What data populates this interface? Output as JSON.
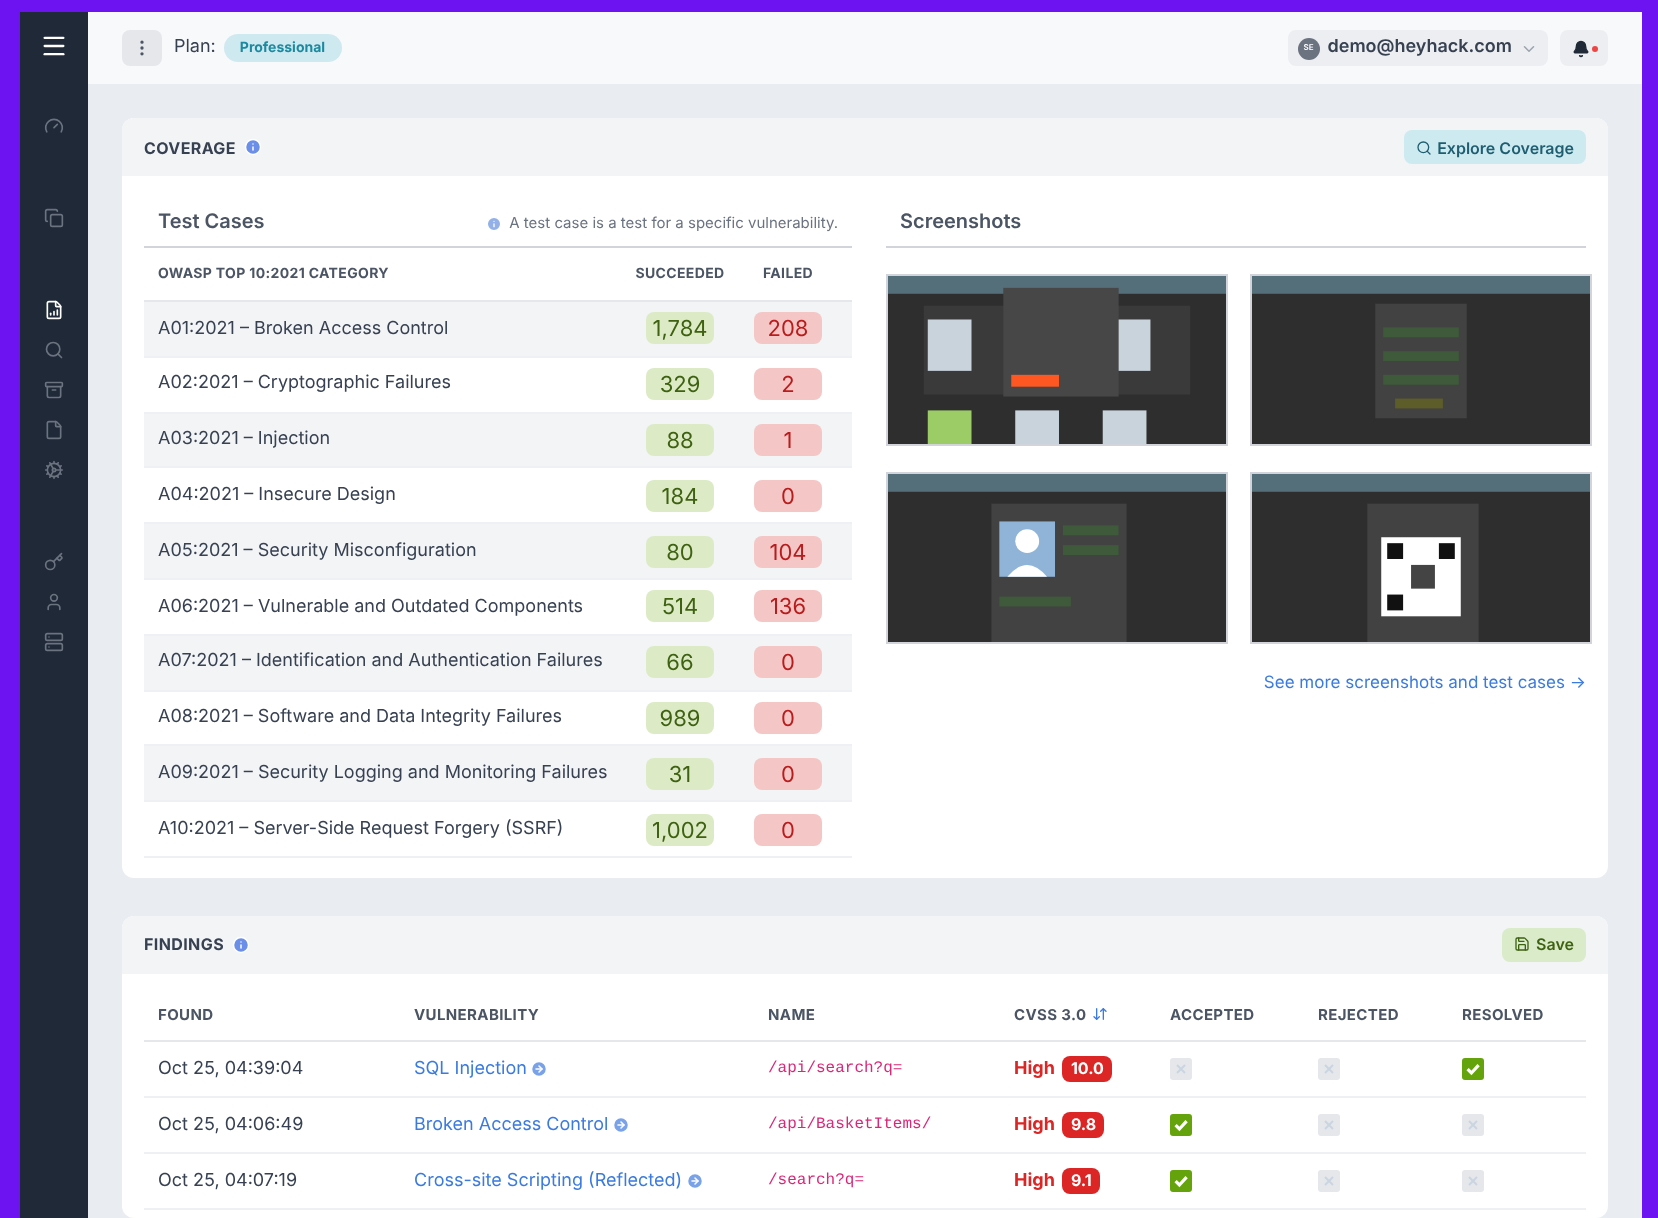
{
  "header": {
    "plan_label": "Plan:",
    "plan": "Professional",
    "user": "demo@heyhack.com",
    "user_initials": "SE",
    "notification_unread": true
  },
  "sidebar": {
    "items": [
      {
        "selected": false
      },
      {
        "selected": false
      },
      {
        "selected": true
      },
      {
        "selected": false
      },
      {
        "selected": false
      },
      {
        "selected": false
      },
      {
        "selected": false
      },
      {
        "selected": false
      },
      {
        "selected": false
      },
      {
        "selected": false
      }
    ]
  },
  "coverage": {
    "title": "COVERAGE",
    "button": "Explore Coverage",
    "test_cases_title": "Test Cases",
    "hint": "A test case is a test for a specific vulnerability.",
    "columns": [
      "OWASP TOP 10:2021 CATEGORY",
      "SUCCEEDED",
      "FAILED"
    ],
    "rows": [
      {
        "category": "A01:2021 – Broken Access Control",
        "succeeded": "1,784",
        "failed": "208"
      },
      {
        "category": "A02:2021 – Cryptographic Failures",
        "succeeded": "329",
        "failed": "2"
      },
      {
        "category": "A03:2021 – Injection",
        "succeeded": "88",
        "failed": "1"
      },
      {
        "category": "A04:2021 – Insecure Design",
        "succeeded": "184",
        "failed": "0"
      },
      {
        "category": "A05:2021 – Security Misconfiguration",
        "succeeded": "80",
        "failed": "104"
      },
      {
        "category": "A06:2021 – Vulnerable and Outdated Components",
        "succeeded": "514",
        "failed": "136"
      },
      {
        "category": "A07:2021 – Identification and Authentication Failures",
        "succeeded": "66",
        "failed": "0"
      },
      {
        "category": "A08:2021 – Software and Data Integrity Failures",
        "succeeded": "989",
        "failed": "0"
      },
      {
        "category": "A09:2021 – Security Logging and Monitoring Failures",
        "succeeded": "31",
        "failed": "0"
      },
      {
        "category": "A10:2021 – Server-Side Request Forgery (SSRF)",
        "succeeded": "1,002",
        "failed": "0"
      }
    ],
    "screenshots_title": "Screenshots",
    "screenshots": [
      {
        "kind": "picture"
      },
      {
        "kind": "picture"
      },
      {
        "kind": "picture"
      },
      {
        "kind": "picture"
      }
    ],
    "more_link": "See more screenshots and test cases →"
  },
  "findings": {
    "title": "FINDINGS",
    "button": "Save",
    "columns": [
      "FOUND",
      "VULNERABILITY",
      "NAME",
      "CVSS 3.0",
      "ACCEPTED",
      "REJECTED",
      "RESOLVED"
    ],
    "rows": [
      {
        "found": "Oct 25, 04:39:04",
        "vulnerability": "SQL Injection",
        "name": "/api/search?q=",
        "severity": "High",
        "score": "10.0",
        "accepted": false,
        "rejected": false,
        "resolved": true
      },
      {
        "found": "Oct 25, 04:06:49",
        "vulnerability": "Broken Access Control",
        "name": "/api/BasketItems/",
        "severity": "High",
        "score": "9.8",
        "accepted": true,
        "rejected": false,
        "resolved": false
      },
      {
        "found": "Oct 25, 04:07:19",
        "vulnerability": "Cross-site Scripting (Reflected)",
        "name": "/search?q=",
        "severity": "High",
        "score": "9.1",
        "accepted": true,
        "rejected": false,
        "resolved": false
      }
    ]
  }
}
